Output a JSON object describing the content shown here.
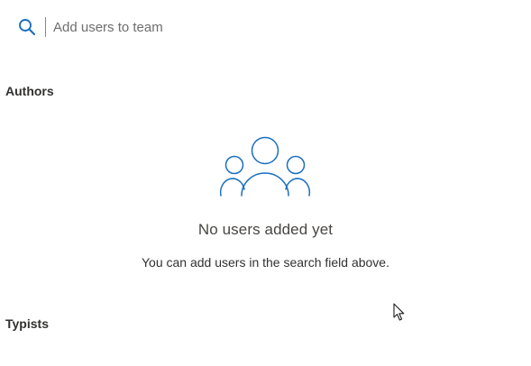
{
  "search": {
    "placeholder": "Add users to team",
    "icon": "search-icon"
  },
  "sections": {
    "authors": {
      "heading": "Authors",
      "empty_state": {
        "icon": "users-group-icon",
        "title": "No users added yet",
        "description": "You can add users in the search field above."
      }
    },
    "typists": {
      "heading": "Typists"
    }
  },
  "colors": {
    "accent": "#1a6fc0",
    "text": "#323130",
    "muted": "#6e6e6e"
  }
}
